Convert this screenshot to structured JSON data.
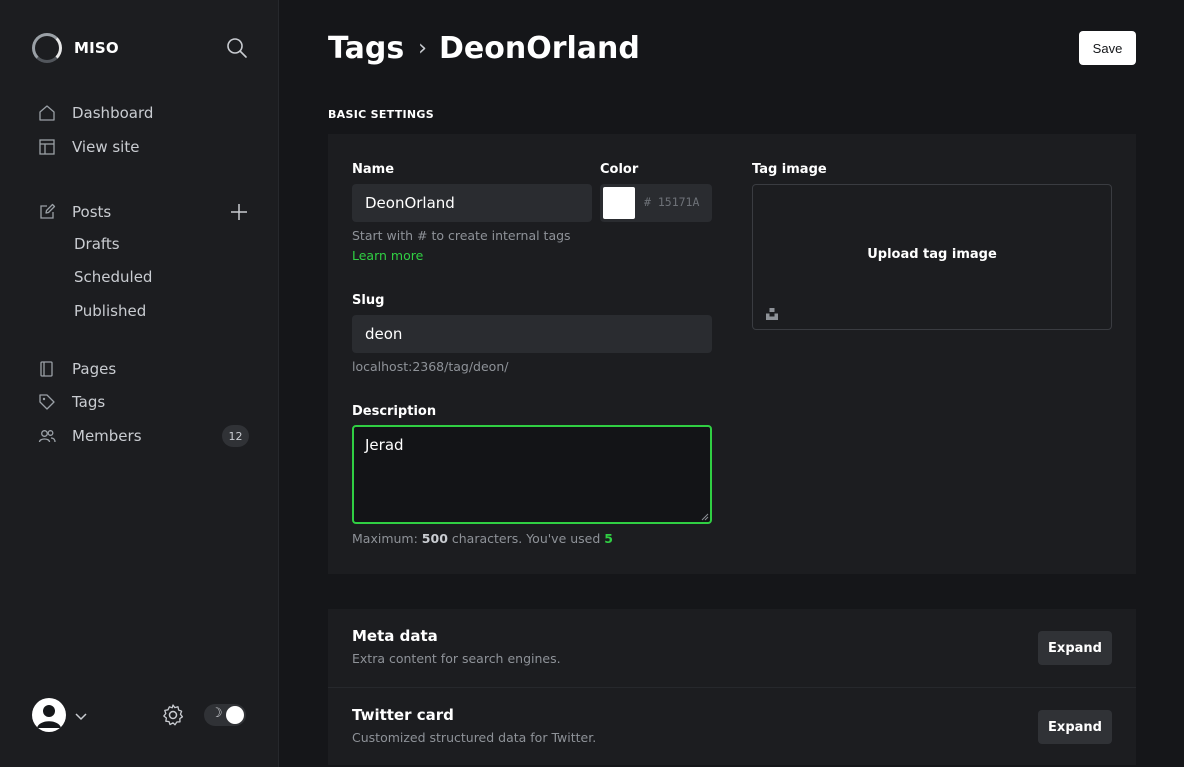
{
  "brand": {
    "name": "MISO"
  },
  "sidebar": {
    "nav": [
      {
        "label": "Dashboard",
        "icon": "home-icon"
      },
      {
        "label": "View site",
        "icon": "layout-icon"
      },
      {
        "label": "Posts",
        "icon": "edit-icon"
      },
      {
        "label": "Pages",
        "icon": "page-icon"
      },
      {
        "label": "Tags",
        "icon": "tag-icon"
      },
      {
        "label": "Members",
        "icon": "members-icon"
      }
    ],
    "posts_sub": [
      "Drafts",
      "Scheduled",
      "Published"
    ],
    "members_count": "12"
  },
  "header": {
    "breadcrumb_parent": "Tags",
    "breadcrumb_separator": "›",
    "breadcrumb_current": "DeonOrland",
    "save_label": "Save"
  },
  "basic": {
    "section_title": "BASIC SETTINGS",
    "name_label": "Name",
    "name_value": "DeonOrland",
    "name_hint": "Start with # to create internal tags",
    "name_hint_link": "Learn more",
    "color_label": "Color",
    "color_value": "# 15171A",
    "color_swatch": "#ffffff",
    "slug_label": "Slug",
    "slug_value": "deon",
    "slug_url": "localhost:2368/tag/deon/",
    "description_label": "Description",
    "description_value": "Jerad",
    "desc_hint_prefix": "Maximum:",
    "desc_hint_max": "500",
    "desc_hint_mid": "characters. You've used",
    "desc_hint_used": "5",
    "tag_image_label": "Tag image",
    "upload_label": "Upload tag image"
  },
  "panels": [
    {
      "title": "Meta data",
      "description": "Extra content for search engines.",
      "button": "Expand"
    },
    {
      "title": "Twitter card",
      "description": "Customized structured data for Twitter.",
      "button": "Expand"
    }
  ],
  "theme": {
    "accent": "#30cf43",
    "background": "#151619",
    "sidebar": "#1c1d20"
  },
  "toggle": {
    "icon": "☽"
  }
}
